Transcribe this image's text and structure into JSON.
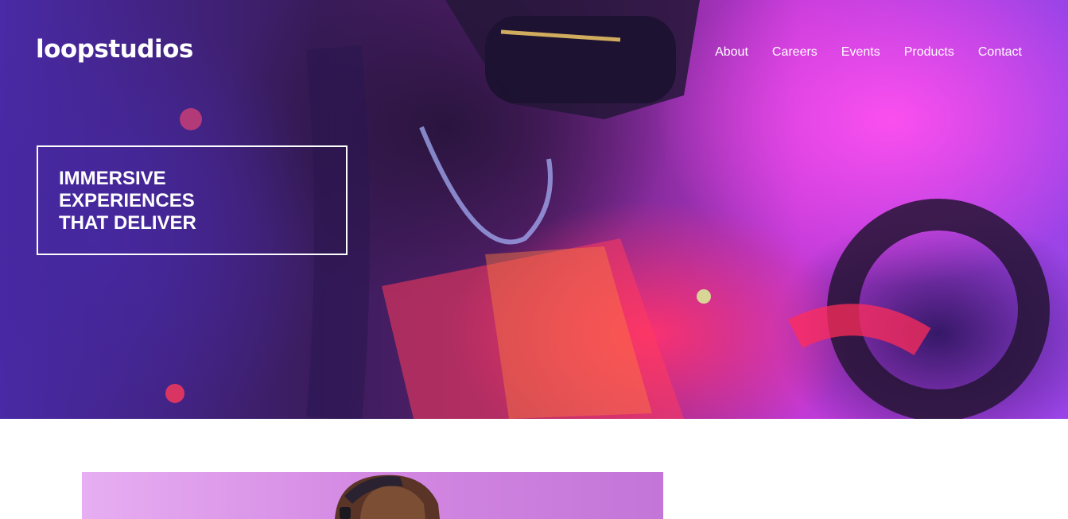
{
  "header": {
    "logo": "loopstudios",
    "nav": [
      {
        "label": "About"
      },
      {
        "label": "Careers"
      },
      {
        "label": "Events"
      },
      {
        "label": "Products"
      },
      {
        "label": "Contact"
      }
    ]
  },
  "hero": {
    "headline_lines": [
      "IMMERSIVE",
      "EXPERIENCES",
      "THAT DELIVER"
    ]
  },
  "colors": {
    "text_on_hero": "#ffffff",
    "accent_pink": "#ff46e6",
    "accent_red": "#ff2f6a",
    "accent_violet": "#6a34d6",
    "page_background": "#ffffff"
  },
  "icons": {
    "feature_image_subject": "vr-headset"
  }
}
